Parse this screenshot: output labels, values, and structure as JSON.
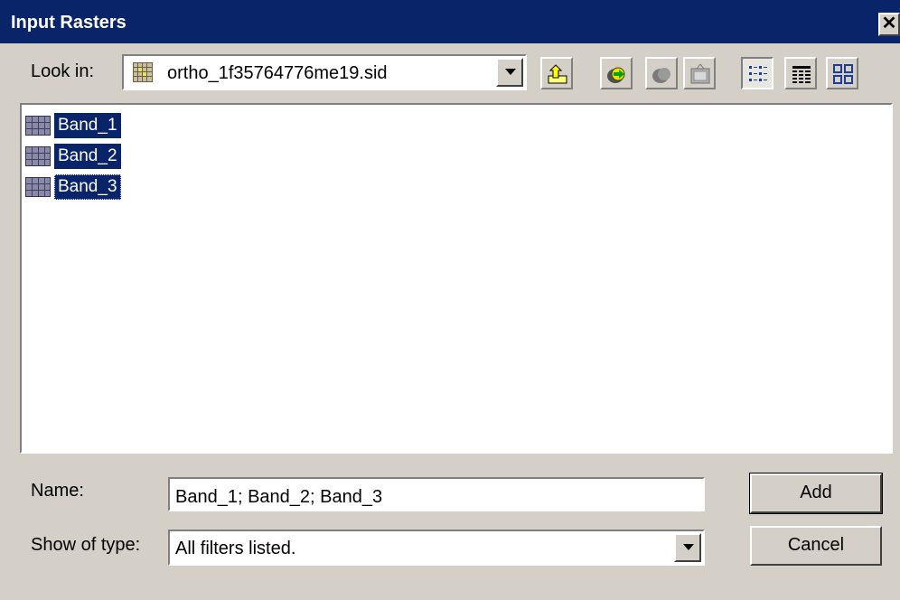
{
  "window": {
    "title": "Input Rasters",
    "close_glyph": "✕"
  },
  "lookin": {
    "label": "Look in:",
    "value": "ortho_1f35764776me19.sid",
    "icon": "raster-dataset-icon"
  },
  "toolbar": {
    "buttons": [
      {
        "name": "up-one-level-icon"
      },
      {
        "name": "connect-folder-icon"
      },
      {
        "name": "disconnect-folder-icon"
      },
      {
        "name": "catalog-options-icon"
      },
      {
        "name": "list-view-icon",
        "pressed": true
      },
      {
        "name": "details-view-icon"
      },
      {
        "name": "thumbnails-view-icon"
      }
    ]
  },
  "files": [
    {
      "name": "Band_1",
      "selected": true,
      "icon": "raster-band-icon"
    },
    {
      "name": "Band_2",
      "selected": true,
      "icon": "raster-band-icon"
    },
    {
      "name": "Band_3",
      "selected": true,
      "focused": true,
      "icon": "raster-band-icon"
    }
  ],
  "name_field": {
    "label": "Name:",
    "value": "Band_1; Band_2; Band_3"
  },
  "type_field": {
    "label": "Show of type:",
    "value": "All filters listed."
  },
  "buttons": {
    "add": "Add",
    "cancel": "Cancel"
  },
  "colors": {
    "titlebar": "#0a246a",
    "selection": "#0a246a",
    "face": "#d4d0c8"
  }
}
